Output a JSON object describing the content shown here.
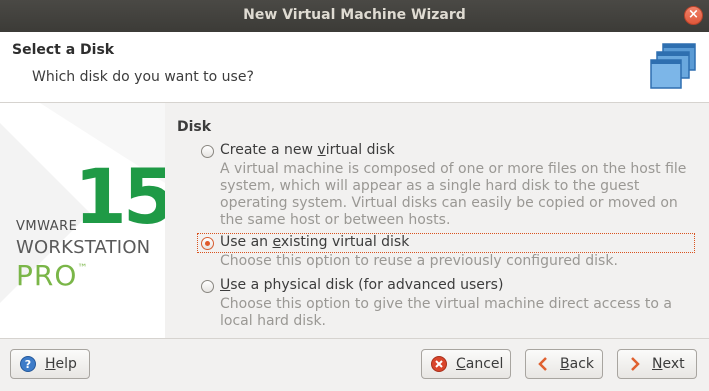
{
  "window": {
    "title": "New Virtual Machine Wizard",
    "close_glyph": "×"
  },
  "header": {
    "title": "Select a Disk",
    "subtitle": "Which disk do you want to use?",
    "icon": "stacked-windows-icon"
  },
  "brand": {
    "number": "15",
    "vendor": "VMWARE",
    "product": "WORKSTATION",
    "edition": "PRO",
    "trademark": "™"
  },
  "disk": {
    "label": "Disk",
    "selected": "existing",
    "options": [
      {
        "id": "new",
        "label_pre": "Create a new ",
        "label_u": "v",
        "label_post": "irtual disk",
        "description": "A virtual machine is composed of one or more files on the host file system, which will appear as a single hard disk to the guest operating system. Virtual disks can easily be copied or moved on the same host or between hosts."
      },
      {
        "id": "existing",
        "label_pre": "Use an ",
        "label_u": "e",
        "label_post": "xisting virtual disk",
        "description": "Choose this option to reuse a previously configured disk."
      },
      {
        "id": "physical",
        "label_pre": "",
        "label_u": "U",
        "label_post": "se a physical disk (for advanced users)",
        "description": "Choose this option to give the virtual machine direct access to a local hard disk."
      }
    ]
  },
  "buttons": {
    "help": {
      "u": "H",
      "rest": "elp",
      "icon": "help-icon"
    },
    "cancel": {
      "u": "C",
      "rest": "ancel",
      "icon": "cancel-icon"
    },
    "back": {
      "u": "B",
      "rest": "ack",
      "icon": "back-arrow-icon"
    },
    "next": {
      "u": "N",
      "rest": "ext",
      "icon": "next-arrow-icon"
    }
  },
  "colors": {
    "accent": "#e05a2b",
    "brand_green": "#1f9a46",
    "pro_green": "#7ab648"
  }
}
